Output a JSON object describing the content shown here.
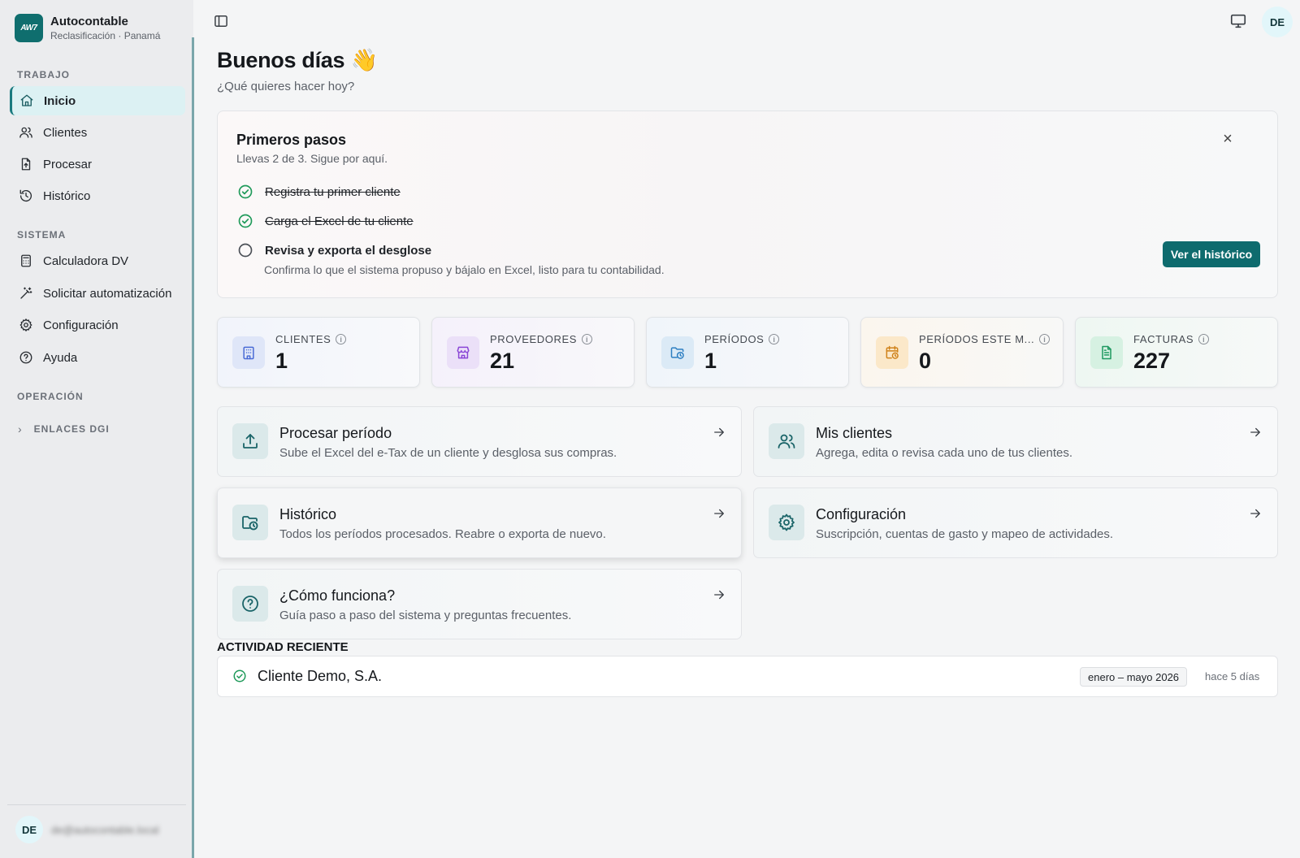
{
  "brand": {
    "logo": "AW7",
    "name": "Autocontable",
    "sub": "Reclasificación · Panamá"
  },
  "sidebar": {
    "sections": [
      {
        "title": "TRABAJO"
      },
      {
        "title": "SISTEMA"
      },
      {
        "title": "OPERACIÓN"
      }
    ],
    "items": [
      {
        "label": "Inicio",
        "icon": "home-icon"
      },
      {
        "label": "Clientes",
        "icon": "users-icon"
      },
      {
        "label": "Procesar",
        "icon": "file-upload-icon"
      },
      {
        "label": "Histórico",
        "icon": "history-icon"
      },
      {
        "label": "Calculadora DV",
        "icon": "calculator-icon"
      },
      {
        "label": "Solicitar automatización",
        "icon": "wand-icon"
      },
      {
        "label": "Configuración",
        "icon": "gear-icon"
      },
      {
        "label": "Ayuda",
        "icon": "help-icon"
      }
    ],
    "dgi_label": "ENLACES DGI",
    "user_initials": "DE",
    "user_email": "de@autocontable.local"
  },
  "header": {
    "avatar": "DE",
    "title": "Buenos días 👋",
    "subtitle": "¿Qué quieres hacer hoy?"
  },
  "steps": {
    "title": "Primeros pasos",
    "subtitle": "Llevas 2 de 3. Sigue por aquí.",
    "items": [
      {
        "label": "Registra tu primer cliente",
        "done": true
      },
      {
        "label": "Carga el Excel de tu cliente",
        "done": true
      },
      {
        "label": "Revisa y exporta el desglose",
        "done": false
      }
    ],
    "current_desc": "Confirma lo que el sistema propuso y bájalo en Excel, listo para tu contabilidad.",
    "cta": "Ver el histórico",
    "close": "×"
  },
  "stats": [
    {
      "label": "CLIENTES",
      "value": "1",
      "icon": "building-icon",
      "color": "#4a6bd6"
    },
    {
      "label": "PROVEEDORES",
      "value": "21",
      "icon": "store-icon",
      "color": "#8a45d6"
    },
    {
      "label": "PERÍODOS",
      "value": "1",
      "icon": "folder-clock-icon",
      "color": "#2d7fc2"
    },
    {
      "label": "PERÍODOS ESTE M...",
      "value": "0",
      "icon": "calendar-clock-icon",
      "color": "#d0821a"
    },
    {
      "label": "FACTURAS",
      "value": "227",
      "icon": "document-icon",
      "color": "#1e9960"
    }
  ],
  "actions": [
    {
      "title": "Procesar período",
      "desc": "Sube el Excel del e-Tax de un cliente y desglosa sus compras.",
      "icon": "upload-icon"
    },
    {
      "title": "Mis clientes",
      "desc": "Agrega, edita o revisa cada uno de tus clientes.",
      "icon": "users-icon"
    },
    {
      "title": "Histórico",
      "desc": "Todos los períodos procesados. Reabre o exporta de nuevo.",
      "icon": "folder-clock-icon"
    },
    {
      "title": "Configuración",
      "desc": "Suscripción, cuentas de gasto y mapeo de actividades.",
      "icon": "gear-icon"
    },
    {
      "title": "¿Cómo funciona?",
      "desc": "Guía paso a paso del sistema y preguntas frecuentes.",
      "icon": "help-icon"
    }
  ],
  "activity": {
    "title": "ACTIVIDAD RECIENTE",
    "items": [
      {
        "name": "Cliente Demo, S.A.",
        "period": "enero – mayo 2026",
        "time": "hace 5 días"
      }
    ]
  }
}
